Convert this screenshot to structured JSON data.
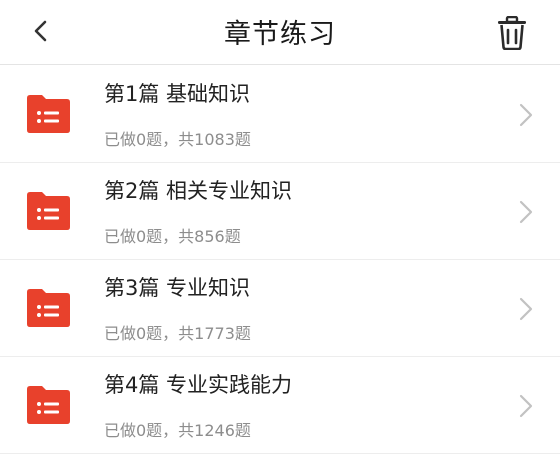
{
  "header": {
    "title": "章节练习",
    "back_icon": "chevron-left-icon",
    "delete_icon": "trash-icon"
  },
  "colors": {
    "accent": "#e8412c",
    "text": "#222222",
    "muted": "#8d8d8d",
    "chevron": "#c2c2c2"
  },
  "chapters": [
    {
      "title": "第1篇 基础知识",
      "progress": "已做0题，共1083题",
      "icon": "folder-list-icon"
    },
    {
      "title": "第2篇 相关专业知识",
      "progress": "已做0题，共856题",
      "icon": "folder-list-icon"
    },
    {
      "title": "第3篇 专业知识",
      "progress": "已做0题，共1773题",
      "icon": "folder-list-icon"
    },
    {
      "title": "第4篇 专业实践能力",
      "progress": "已做0题，共1246题",
      "icon": "folder-list-icon"
    }
  ]
}
